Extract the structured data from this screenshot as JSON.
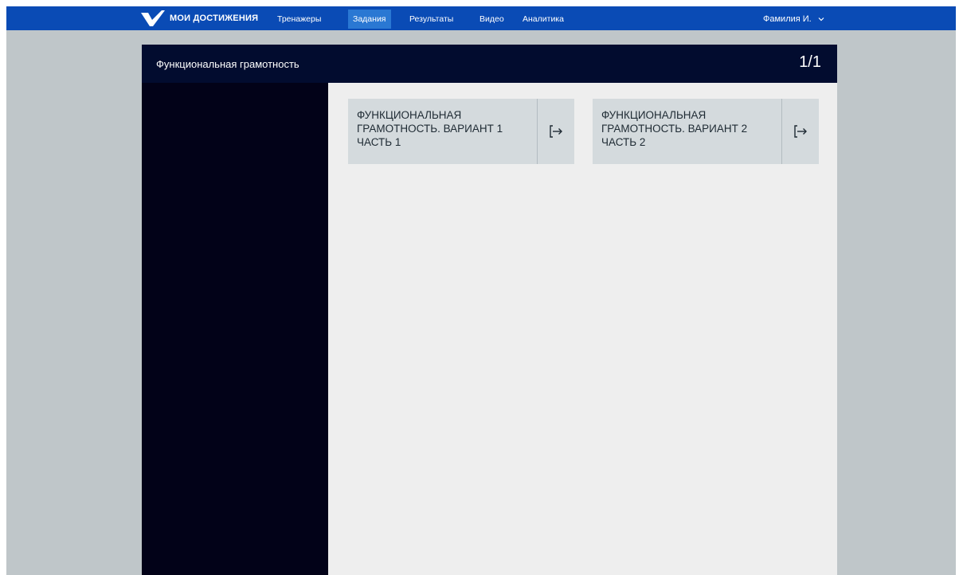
{
  "nav": {
    "logo_text": "МОИ ДОСТИЖЕНИЯ",
    "items": [
      {
        "label": "Тренажеры",
        "active": false
      },
      {
        "label": "Задания",
        "active": true
      },
      {
        "label": "Результаты",
        "active": false
      },
      {
        "label": "Видео",
        "active": false
      },
      {
        "label": "Аналитика",
        "active": false
      }
    ],
    "user_name": "Фамилия И."
  },
  "header": {
    "title": "Функциональная грамотность",
    "page_counter": "1/1"
  },
  "cards": [
    {
      "title": "ФУНКЦИОНАЛЬНАЯ ГРАМОТНОСТЬ. ВАРИАНТ 1 ЧАСТЬ 1",
      "action_icon": "enter-icon"
    },
    {
      "title": "ФУНКЦИОНАЛЬНАЯ ГРАМОТНОСТЬ. ВАРИАНТ 2 ЧАСТЬ 2",
      "action_icon": "enter-icon"
    }
  ],
  "colors": {
    "nav_bg": "#0a4bb5",
    "nav_active": "#2a78d3",
    "page_bg": "#bfc6c9",
    "header_bg": "#020c2f",
    "sidebar_bg": "#020218",
    "content_bg": "#eeeeee",
    "card_bg": "#d4dadd"
  }
}
